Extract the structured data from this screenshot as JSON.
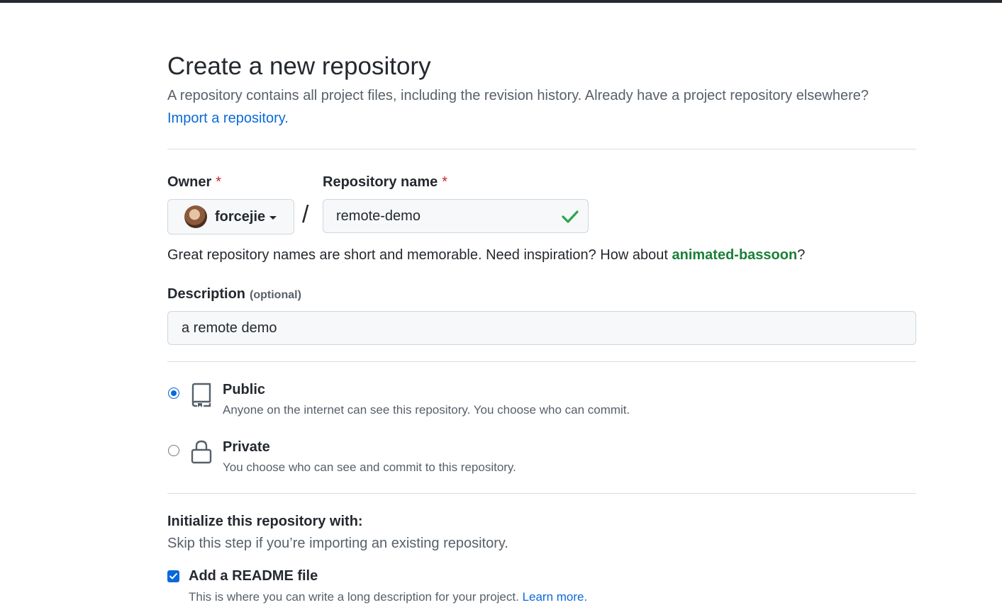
{
  "header": {
    "title": "Create a new repository",
    "subtitle": "A repository contains all project files, including the revision history. Already have a project repository elsewhere?",
    "import_link": "Import a repository."
  },
  "owner": {
    "label": "Owner",
    "required_mark": "*",
    "value": "forcejie",
    "icon": "chevron-down-icon"
  },
  "separator": "/",
  "repo_name": {
    "label": "Repository name",
    "required_mark": "*",
    "value": "remote-demo",
    "status_icon": "check-icon",
    "status_color": "#2da44e"
  },
  "name_hint": {
    "prefix": "Great repository names are short and memorable. Need inspiration? How about ",
    "suggestion": "animated-bassoon",
    "suffix": "?"
  },
  "description": {
    "label": "Description",
    "optional_text": "(optional)",
    "value": "a remote demo"
  },
  "visibility": {
    "options": [
      {
        "title": "Public",
        "description": "Anyone on the internet can see this repository. You choose who can commit.",
        "icon": "repo-icon",
        "selected": true
      },
      {
        "title": "Private",
        "description": "You choose who can see and commit to this repository.",
        "icon": "lock-icon",
        "selected": false
      }
    ]
  },
  "initialize": {
    "title": "Initialize this repository with:",
    "subtitle": "Skip this step if you’re importing an existing repository.",
    "readme": {
      "label": "Add a README file",
      "description": "This is where you can write a long description for your project.",
      "learn_more": "Learn more.",
      "checked": true
    }
  },
  "colors": {
    "link": "#0969da",
    "suggestion": "#1a7f37",
    "required": "#cf222e",
    "accent": "#0969da"
  }
}
